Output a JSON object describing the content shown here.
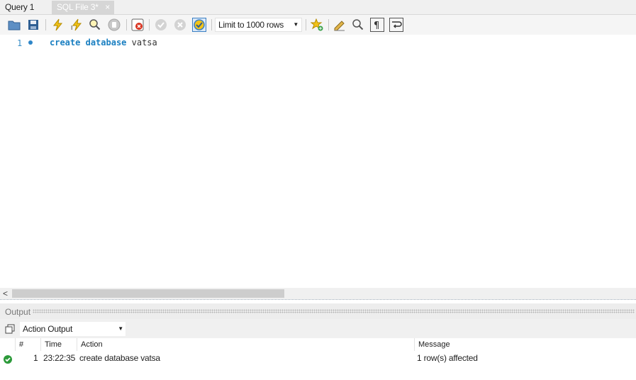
{
  "tabs": [
    {
      "label": "Query 1"
    },
    {
      "label": "SQL File 3*",
      "close": "×"
    }
  ],
  "toolbar": {
    "limit_select": "Limit to 1000 rows",
    "icons": [
      "open-file-icon",
      "save-icon",
      "execute-icon",
      "execute-current-icon",
      "explain-icon",
      "stop-icon",
      "toggle-error-stop-icon",
      "commit-icon",
      "rollback-icon",
      "autocommit-icon",
      "add-snippet-icon",
      "beautify-icon",
      "find-icon",
      "invisible-chars-icon",
      "word-wrap-icon"
    ]
  },
  "editor": {
    "line_number": "1",
    "code": {
      "kw1": "create",
      "kw2": "database",
      "ident": "vatsa"
    }
  },
  "output": {
    "title": "Output",
    "selected_view": "Action Output",
    "columns": [
      "#",
      "Time",
      "Action",
      "Message"
    ],
    "rows": [
      {
        "num": "1",
        "time": "23:22:35",
        "action": "create database vatsa",
        "message": "1 row(s) affected",
        "status": "success"
      }
    ]
  },
  "scroll": {
    "left_arrow": "<"
  },
  "colors": {
    "keyword": "#1a7fc1",
    "success": "#2c9a3a",
    "accent": "#3a8fc8"
  }
}
